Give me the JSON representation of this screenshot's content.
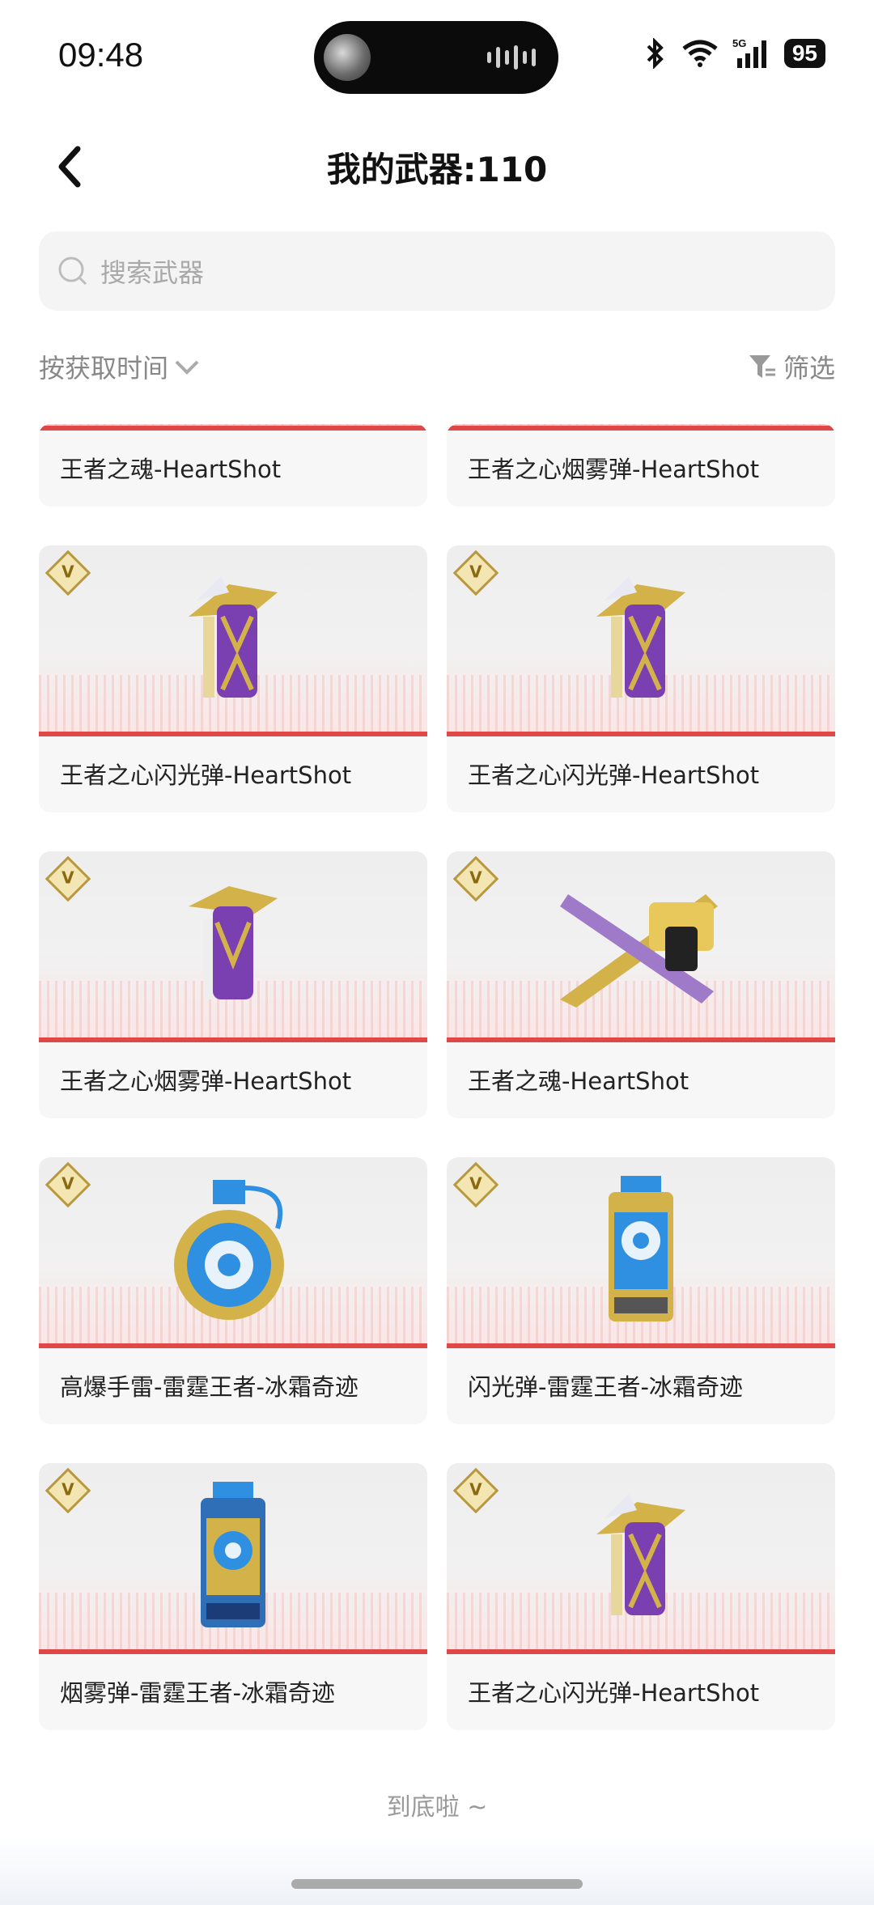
{
  "status_bar": {
    "time": "09:48",
    "battery": "95",
    "network": "5G"
  },
  "header": {
    "title": "我的武器:110"
  },
  "search": {
    "placeholder": "搜索武器"
  },
  "sort": {
    "label": "按获取时间"
  },
  "filter": {
    "label": "筛选"
  },
  "cards": [
    {
      "name": "王者之魂-HeartShot",
      "art": "none"
    },
    {
      "name": "王者之心烟雾弹-HeartShot",
      "art": "none"
    },
    {
      "name": "王者之心闪光弹-HeartShot",
      "art": "purple-canister"
    },
    {
      "name": "王者之心闪光弹-HeartShot",
      "art": "purple-canister"
    },
    {
      "name": "王者之心烟雾弹-HeartShot",
      "art": "purple-smoke"
    },
    {
      "name": "王者之魂-HeartShot",
      "art": "pistol"
    },
    {
      "name": "高爆手雷-雷霆王者-冰霜奇迹",
      "art": "blue-grenade"
    },
    {
      "name": "闪光弹-雷霆王者-冰霜奇迹",
      "art": "blue-canister"
    },
    {
      "name": "烟雾弹-雷霆王者-冰霜奇迹",
      "art": "blue-smoke"
    },
    {
      "name": "王者之心闪光弹-HeartShot",
      "art": "purple-canister"
    }
  ],
  "badge_letter": "V",
  "footer": {
    "end_text": "到底啦 ~"
  },
  "colors": {
    "accent_red": "#e04848",
    "gold": "#d4b24a",
    "purple": "#7a3fb0",
    "blue": "#2f8fe0"
  }
}
